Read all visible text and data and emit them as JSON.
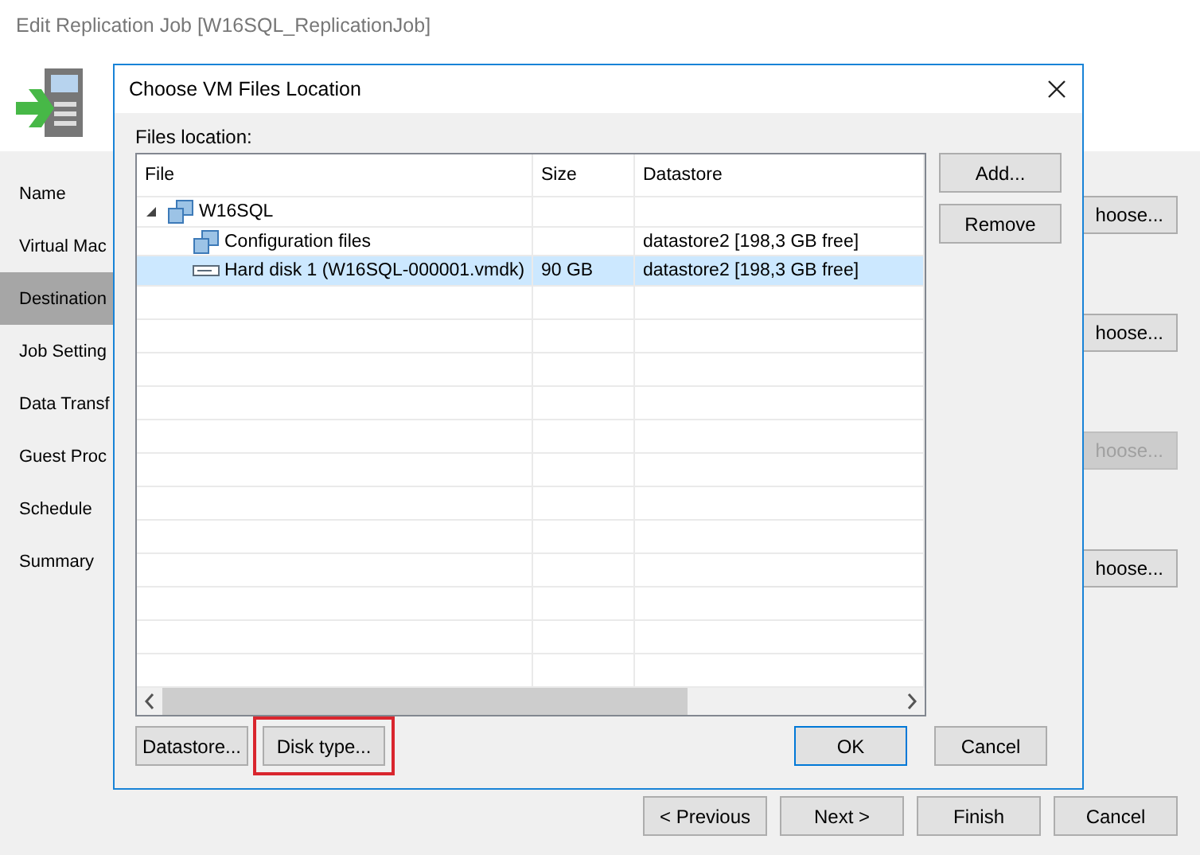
{
  "window": {
    "title": "Edit Replication Job [W16SQL_ReplicationJob]"
  },
  "steps": [
    {
      "label": "Name",
      "selected": false
    },
    {
      "label": "Virtual Mac",
      "selected": false
    },
    {
      "label": "Destination",
      "selected": true
    },
    {
      "label": "Job Setting",
      "selected": false
    },
    {
      "label": "Data Transf",
      "selected": false
    },
    {
      "label": "Guest Proc",
      "selected": false
    },
    {
      "label": "Schedule",
      "selected": false
    },
    {
      "label": "Summary",
      "selected": false
    }
  ],
  "choose_buttons": [
    {
      "label": "hoose...",
      "disabled": false
    },
    {
      "label": "hoose...",
      "disabled": false
    },
    {
      "label": "hoose...",
      "disabled": true
    },
    {
      "label": "hoose...",
      "disabled": false
    }
  ],
  "dialog": {
    "title": "Choose VM Files Location",
    "files_label": "Files location:",
    "table": {
      "columns": [
        "File",
        "Size",
        "Datastore"
      ],
      "tree": [
        {
          "file": "W16SQL",
          "kind": "vm",
          "expanded": true,
          "selected": false,
          "children": [
            {
              "file": "Configuration files",
              "datastore": "datastore2 [198,3 GB free]",
              "kind": "config",
              "selected": false
            },
            {
              "file": "Hard disk 1 (W16SQL-000001.vmdk)",
              "size": "90 GB",
              "datastore": "datastore2 [198,3 GB free]",
              "kind": "disk",
              "selected": true
            }
          ]
        }
      ]
    },
    "side_buttons": [
      "Add...",
      "Remove"
    ],
    "bottom_buttons": [
      {
        "label": "Datastore...",
        "highlighted": false
      },
      {
        "label": "Disk type...",
        "highlighted": true
      }
    ],
    "ok": "OK",
    "cancel": "Cancel"
  },
  "footer_buttons": [
    "< Previous",
    "Next >",
    "Finish",
    "Cancel"
  ]
}
